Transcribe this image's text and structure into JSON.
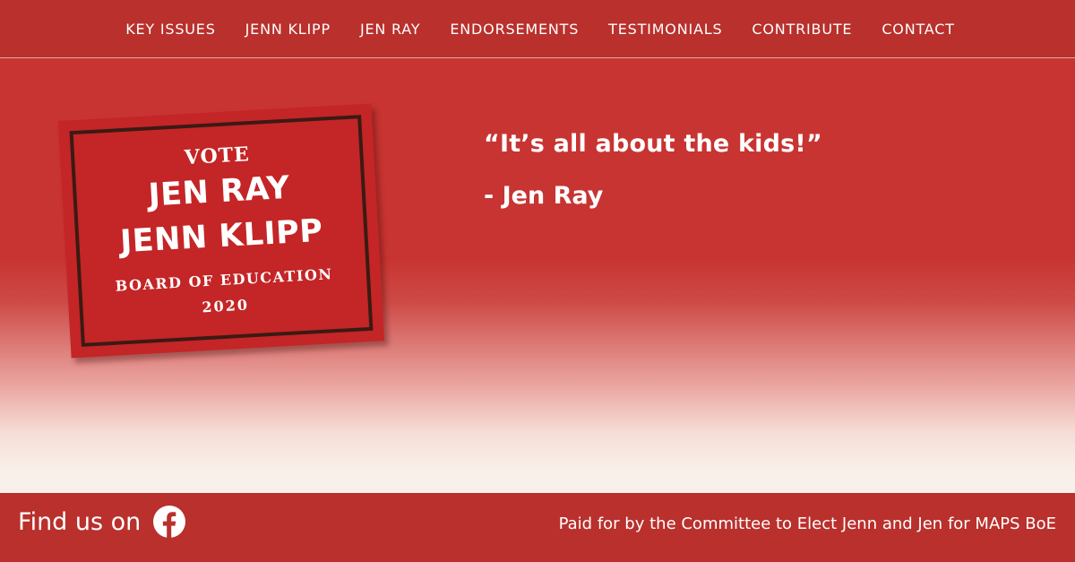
{
  "nav": {
    "items": [
      {
        "label": "KEY ISSUES"
      },
      {
        "label": "JENN KLIPP"
      },
      {
        "label": "JEN RAY"
      },
      {
        "label": "ENDORSEMENTS"
      },
      {
        "label": "TESTIMONIALS"
      },
      {
        "label": "CONTRIBUTE"
      },
      {
        "label": "CONTACT"
      }
    ]
  },
  "hero": {
    "sign": {
      "vote": "VOTE",
      "name_1": "JEN RAY",
      "name_2": "JENN KLIPP",
      "office": "BOARD OF EDUCATION",
      "year": "2020"
    },
    "quote": "“It’s all about the kids!”",
    "attribution": "- Jen Ray"
  },
  "footer": {
    "find_us_label": "Find us on",
    "social_icon": "facebook-icon",
    "paid_for": "Paid for by the Committee to Elect Jenn and Jen for MAPS BoE"
  },
  "colors": {
    "brand_red": "#b9302c",
    "hero_red": "#c73431",
    "sign_red": "#c42526",
    "sign_border": "#3b1a14",
    "text": "#ffffff"
  }
}
